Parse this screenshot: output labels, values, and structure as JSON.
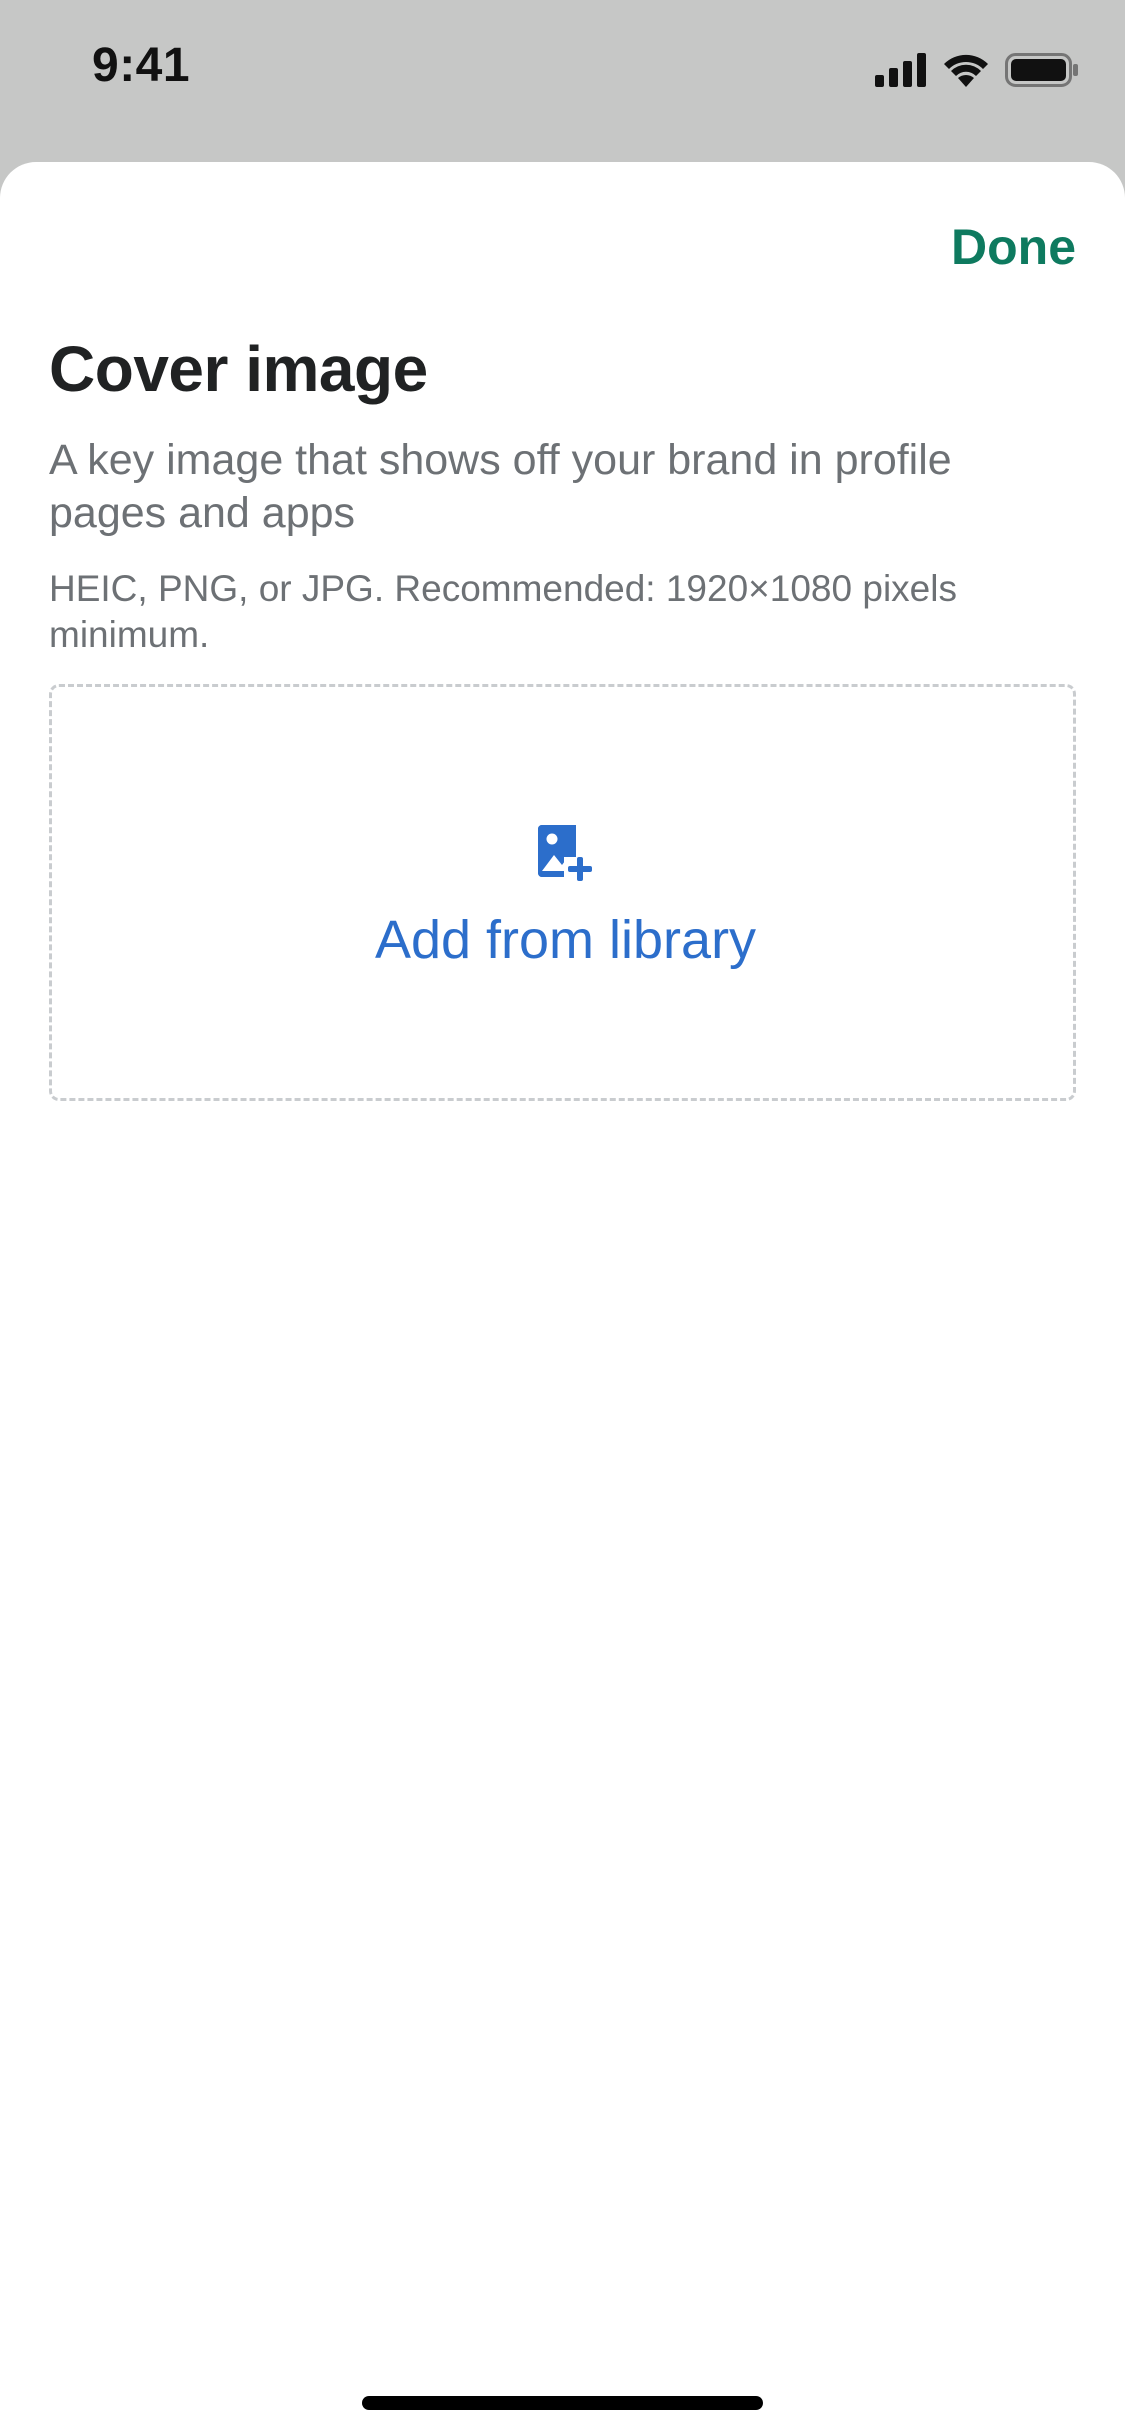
{
  "status_bar": {
    "time": "9:41",
    "icons": [
      "cellular-signal-icon",
      "wifi-icon",
      "battery-icon"
    ]
  },
  "sheet": {
    "done_label": "Done",
    "title": "Cover image",
    "description": "A key image that shows off your brand in profile pages and apps",
    "hint": "HEIC, PNG, or JPG. Recommended: 1920×1080 pixels minimum.",
    "dropzone": {
      "icon": "image-add-icon",
      "label": "Add from library"
    }
  },
  "colors": {
    "accent_done": "#0e7a5f",
    "link_blue": "#2c6ecb",
    "title_text": "#202223",
    "subdued_text": "#6d7175",
    "dim_background": "#c6c7c6"
  }
}
